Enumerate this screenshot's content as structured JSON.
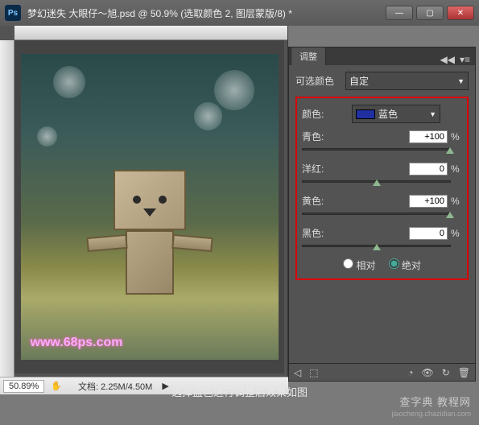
{
  "chrome": {
    "ps_label": "Ps",
    "title": "梦幻迷失 大眼仔～旭.psd @ 50.9% (选取颜色 2, 图层蒙版/8) *"
  },
  "panel": {
    "tab": "调整",
    "adj_label": "可选颜色",
    "preset": "自定",
    "color_label": "颜色:",
    "color_name": "蓝色",
    "sliders": {
      "cyan": {
        "label": "青色:",
        "value": "+100",
        "unit": "%",
        "pos": 100
      },
      "magenta": {
        "label": "洋红:",
        "value": "0",
        "unit": "%",
        "pos": 50
      },
      "yellow": {
        "label": "黄色:",
        "value": "+100",
        "unit": "%",
        "pos": 100
      },
      "black": {
        "label": "黑色:",
        "value": "0",
        "unit": "%",
        "pos": 50
      }
    },
    "relative": "相对",
    "absolute": "绝对"
  },
  "status": {
    "zoom": "50.89%",
    "doc_label": "文档:",
    "doc_value": "2.25M/4.50M"
  },
  "watermark": "www.68ps.com",
  "caption": "选择蓝色进行调整后效果如图",
  "source": {
    "line1": "查字典 教程网",
    "line2": "jiaocheng.chazidian.com"
  }
}
